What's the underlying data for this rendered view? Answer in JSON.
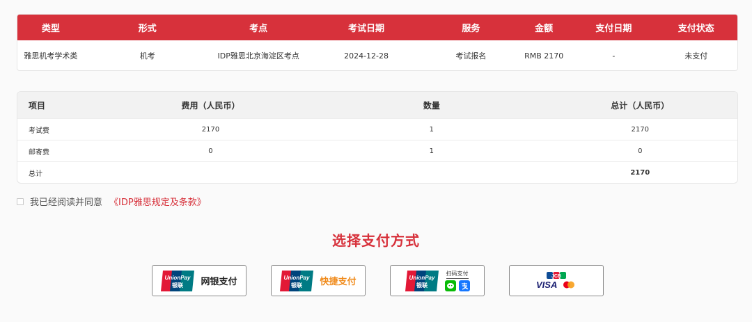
{
  "order_table": {
    "headers": [
      "类型",
      "形式",
      "考点",
      "考试日期",
      "服务",
      "金额",
      "支付日期",
      "支付状态"
    ],
    "row": [
      "雅思机考学术类",
      "机考",
      "IDP雅思北京海淀区考点",
      "2024-12-28",
      "考试报名",
      "RMB 2170",
      "-",
      "未支付"
    ]
  },
  "fee_table": {
    "headers": [
      "项目",
      "费用（人民币）",
      "数量",
      "总计（人民币）"
    ],
    "rows": [
      [
        "考试费",
        "2170",
        "1",
        "2170"
      ],
      [
        "邮寄费",
        "0",
        "1",
        "0"
      ],
      [
        "总计",
        "",
        "",
        "2170"
      ]
    ]
  },
  "agreement": {
    "text": "我已经阅读并同意",
    "link": "《IDP雅思规定及条款》"
  },
  "payment": {
    "title": "选择支付方式",
    "methods": [
      {
        "label": "网银支付",
        "logo_text": "UnionPay",
        "logo_sub": "银联"
      },
      {
        "label": "快捷支付",
        "logo_text": "UnionPay",
        "logo_sub": "银联"
      },
      {
        "label": "扫码支付",
        "logo_text": "UnionPay",
        "logo_sub": "银联"
      },
      {
        "label": "",
        "brand_top": "JCB",
        "brand_bottom": "VISA"
      }
    ]
  },
  "colors": {
    "accent": "#d7313b",
    "orange": "#f08a1a",
    "unionpay_red": "#e21836",
    "unionpay_blue": "#00447c",
    "unionpay_teal": "#007b84"
  }
}
